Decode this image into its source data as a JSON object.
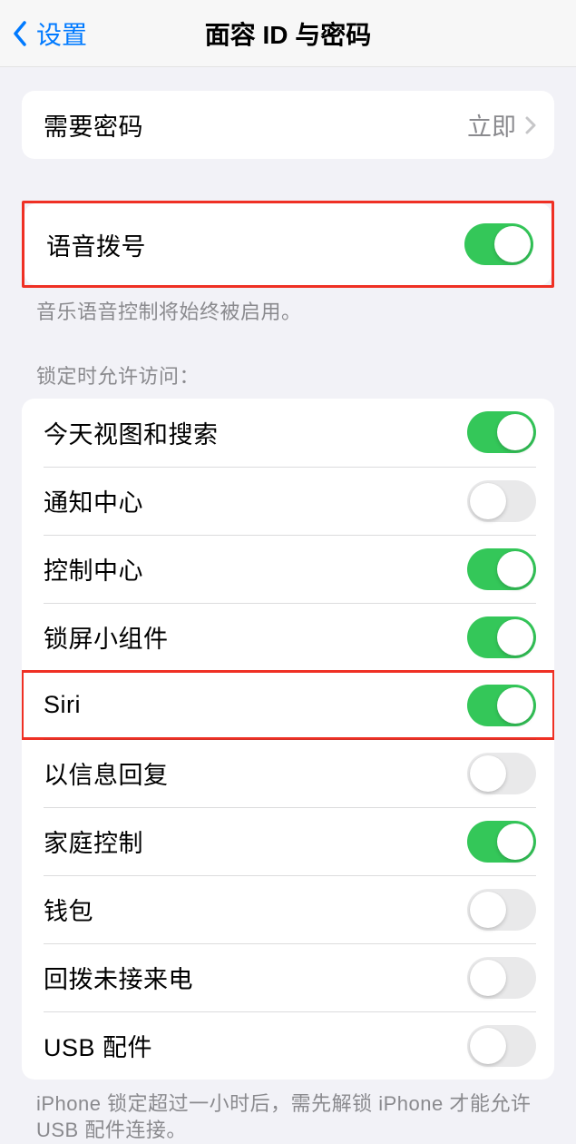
{
  "nav": {
    "back_label": "设置",
    "title": "面容 ID 与密码"
  },
  "require_passcode": {
    "label": "需要密码",
    "value": "立即"
  },
  "voice_dial": {
    "label": "语音拨号",
    "enabled": true,
    "footer": "音乐语音控制将始终被启用。"
  },
  "lock_access": {
    "header": "锁定时允许访问：",
    "items": [
      {
        "label": "今天视图和搜索",
        "enabled": true
      },
      {
        "label": "通知中心",
        "enabled": false
      },
      {
        "label": "控制中心",
        "enabled": true
      },
      {
        "label": "锁屏小组件",
        "enabled": true
      },
      {
        "label": "Siri",
        "enabled": true,
        "highlight": true
      },
      {
        "label": "以信息回复",
        "enabled": false
      },
      {
        "label": "家庭控制",
        "enabled": true
      },
      {
        "label": "钱包",
        "enabled": false
      },
      {
        "label": "回拨未接来电",
        "enabled": false
      },
      {
        "label": "USB 配件",
        "enabled": false
      }
    ],
    "footer": "iPhone 锁定超过一小时后，需先解锁 iPhone 才能允许USB 配件连接。"
  }
}
